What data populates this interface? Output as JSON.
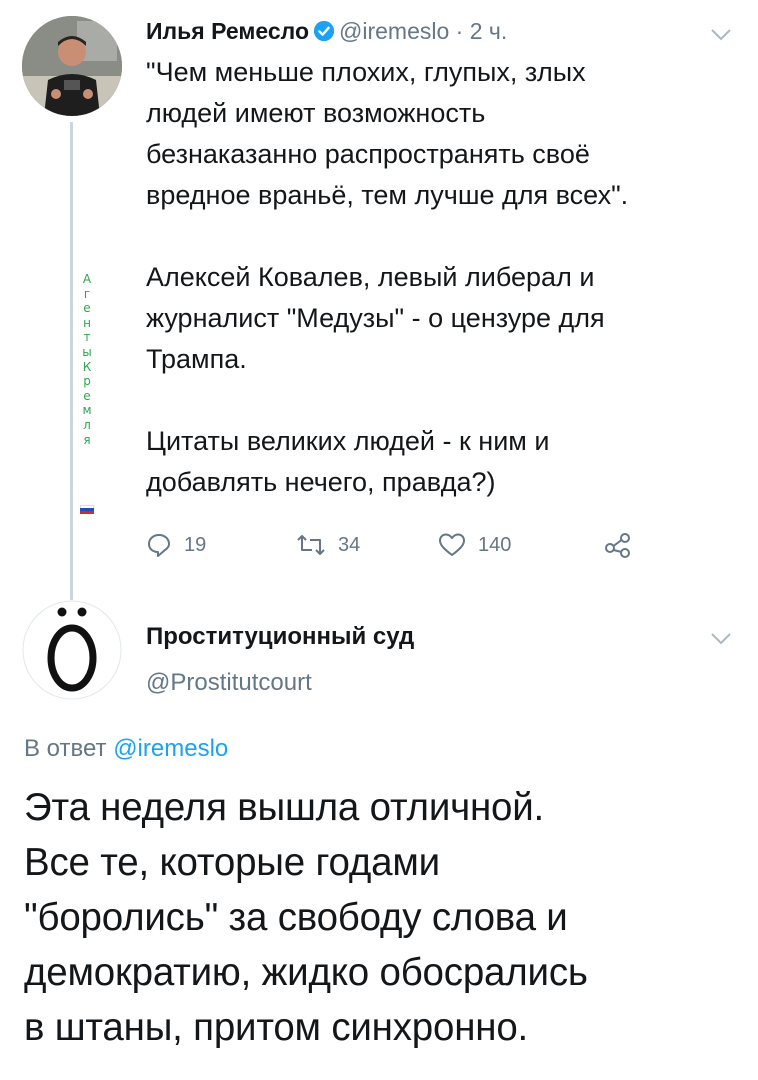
{
  "tweet1": {
    "display_name": "Илья Ремесло",
    "handle_meta": "@iremeslo · 2 ч.",
    "paragraphs": [
      "\"Чем меньше плохих, глупых, злых\nлюдей имеют возможность\nбезнаказанно распространять своё\nвредное враньё, тем лучше для всех\".",
      "Алексей Ковалев, левый либерал и\nжурналист \"Медузы\" - о цензуре для\nТрампа.",
      "Цитаты великих людей - к ним и\nдобавлять нечего, правда?)"
    ],
    "replies": "19",
    "retweets": "34",
    "likes": "140",
    "icons": [
      "verified-badge-icon",
      "chevron-down-icon",
      "reply-icon",
      "retweet-icon",
      "like-icon",
      "share-icon"
    ]
  },
  "watermark": {
    "letters": [
      "А",
      "г",
      "е",
      "н",
      "т",
      "ы",
      "К",
      "р",
      "е",
      "м",
      "л",
      "я"
    ]
  },
  "tweet2": {
    "display_name": "Проституционный суд",
    "handle": "@Prostitutcourt",
    "reply_prefix": "В ответ",
    "reply_mention": "@iremeslo",
    "text": "Эта неделя вышла отличной.\nВсе те, которые годами\n\"боролись\" за свободу слова и\nдемократию, жидко обосрались\nв штаны, притом синхронно.",
    "avatar_letter": "Ö"
  },
  "colors": {
    "verified": "#1da1f2",
    "mention": "#1da1f2",
    "muted": "#657786",
    "text": "#14171a",
    "watermark": "#2fa64f"
  }
}
